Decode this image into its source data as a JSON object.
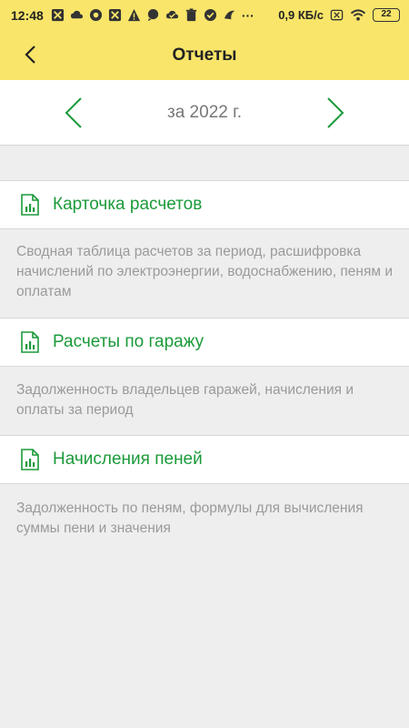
{
  "status_bar": {
    "time": "12:48",
    "speed": "0,9 КБ/с",
    "dots": "···",
    "battery": "22"
  },
  "header": {
    "title": "Отчеты",
    "back_icon": "chevron-left-icon"
  },
  "year_selector": {
    "label": "за 2022 г.",
    "accent": "#1b9a3a"
  },
  "reports": [
    {
      "title": "Карточка расчетов",
      "description": "Сводная таблица расчетов за период, расшифровка начислений по электроэнергии, водоснабжению, пеням и оплатам",
      "icon": "chart-document-icon"
    },
    {
      "title": "Расчеты по гаражу",
      "description": "Задолженность владельцев гаражей, начисления и оплаты за период",
      "icon": "chart-document-icon"
    },
    {
      "title": "Начисления пеней",
      "description": "Задолженность по пеням, формулы для вычисления суммы пени и значения",
      "icon": "chart-document-icon"
    }
  ],
  "colors": {
    "header_bg": "#f8e56a",
    "accent_green": "#1b9a3a",
    "page_bg": "#eeeeee",
    "desc_text": "#9a9a9a"
  }
}
